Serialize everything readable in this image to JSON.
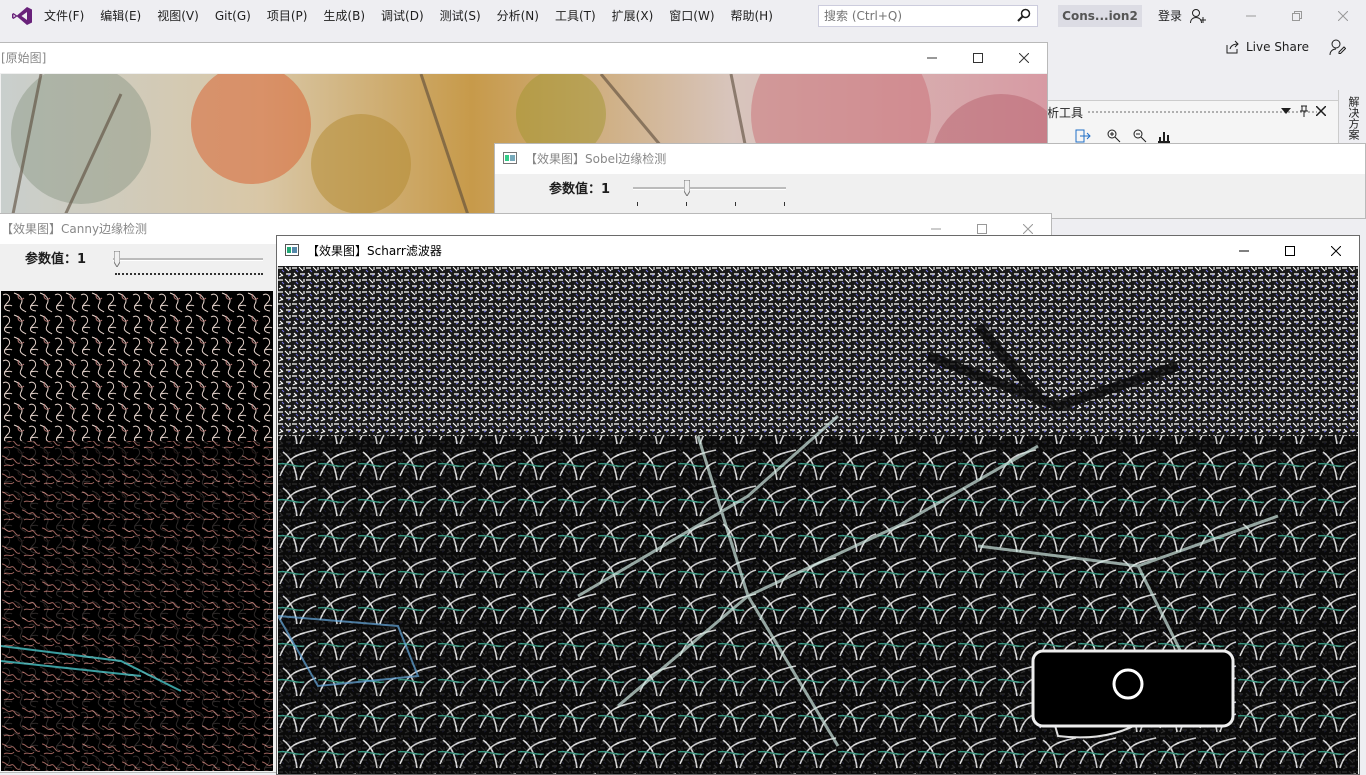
{
  "vs": {
    "menu": [
      "文件(F)",
      "编辑(E)",
      "视图(V)",
      "Git(G)",
      "项目(P)",
      "生成(B)",
      "调试(D)",
      "测试(S)",
      "分析(N)",
      "工具(T)",
      "扩展(X)",
      "窗口(W)",
      "帮助(H)"
    ],
    "search_placeholder": "搜索 (Ctrl+Q)",
    "solution_name": "Cons...ion2",
    "signin": "登录",
    "live_share": "Live Share",
    "tool_window_title": "析工具",
    "side_tab": "解决方案"
  },
  "windows": {
    "original": {
      "title": "[原始图]"
    },
    "sobel": {
      "title": "【效果图】Sobel边缘检测",
      "param_label": "参数值：1",
      "param_value": 1
    },
    "canny": {
      "title": "【效果图】Canny边缘检测",
      "param_label": "参数值：1",
      "param_value": 1
    },
    "scharr": {
      "title": "【效果图】Scharr滤波器"
    }
  },
  "colors": {
    "accent": "#68217a",
    "active_title": "#ffffff",
    "inactive_text": "#888888"
  }
}
